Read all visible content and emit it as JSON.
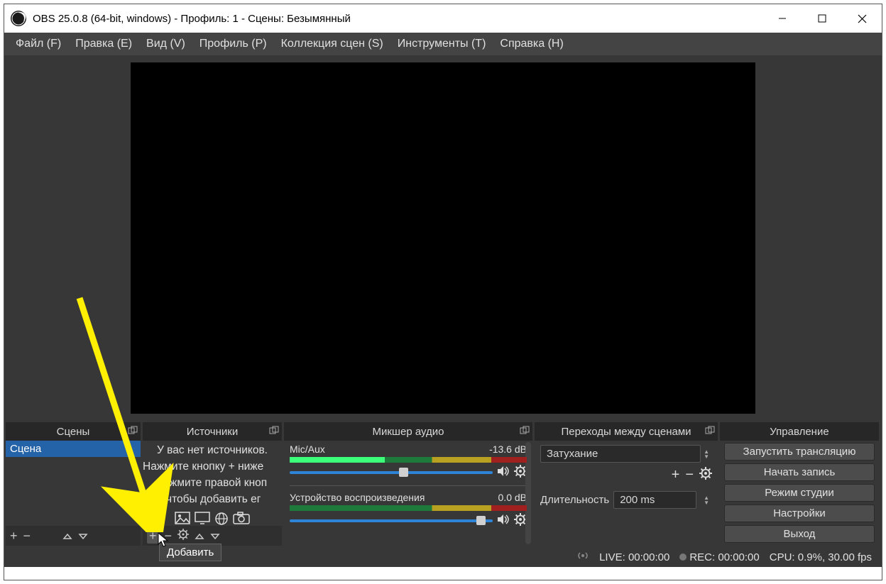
{
  "title": "OBS 25.0.8 (64-bit, windows) - Профиль: 1 - Сцены: Безымянный",
  "menu": [
    "Файл (F)",
    "Правка (E)",
    "Вид (V)",
    "Профиль (P)",
    "Коллекция сцен (S)",
    "Инструменты (T)",
    "Справка (H)"
  ],
  "docks": {
    "scenes": {
      "title": "Сцены",
      "items": [
        "Сцена"
      ]
    },
    "sources": {
      "title": "Источники",
      "empty_lines": [
        "У вас нет источников.",
        "Нажмите кнопку + ниже",
        "нажмите правой кноп",
        "есь, чтобы добавить ег"
      ]
    },
    "mixer": {
      "title": "Микшер аудио",
      "channels": [
        {
          "name": "Mic/Aux",
          "db": "-13.6 dB",
          "thumb": 54,
          "active": true
        },
        {
          "name": "Устройство воспроизведения",
          "db": "0.0 dB",
          "thumb": 92,
          "active": false
        }
      ]
    },
    "transitions": {
      "title": "Переходы между сценами",
      "selected": "Затухание",
      "dur_label": "Длительность",
      "dur_value": "200 ms"
    },
    "controls": {
      "title": "Управление",
      "buttons": [
        "Запустить трансляцию",
        "Начать запись",
        "Режим студии",
        "Настройки",
        "Выход"
      ]
    }
  },
  "status": {
    "live": "LIVE: 00:00:00",
    "rec": "REC: 00:00:00",
    "cpu": "CPU: 0.9%, 30.00 fps"
  },
  "tooltip": "Добавить"
}
